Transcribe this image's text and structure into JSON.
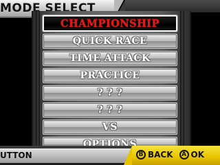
{
  "header": {
    "title": "MODE SELECT"
  },
  "menu": {
    "items": [
      {
        "label": "CHAMPIONSHIP",
        "selected": true
      },
      {
        "label": "QUICK RACE",
        "selected": false
      },
      {
        "label": "TIME ATTACK",
        "selected": false
      },
      {
        "label": "PRACTICE",
        "selected": false
      },
      {
        "label": "? ? ?",
        "selected": false
      },
      {
        "label": "? ? ?",
        "selected": false
      },
      {
        "label": "VS",
        "selected": false
      },
      {
        "label": "OPTIONS",
        "selected": false
      }
    ]
  },
  "footer": {
    "hint": "UTTON",
    "back_button": "B",
    "back_label": "BACK",
    "ok_button": "A",
    "ok_label": "OK"
  },
  "colors": {
    "selected_text": "#e21818",
    "controls_bg": "#f0d010"
  }
}
